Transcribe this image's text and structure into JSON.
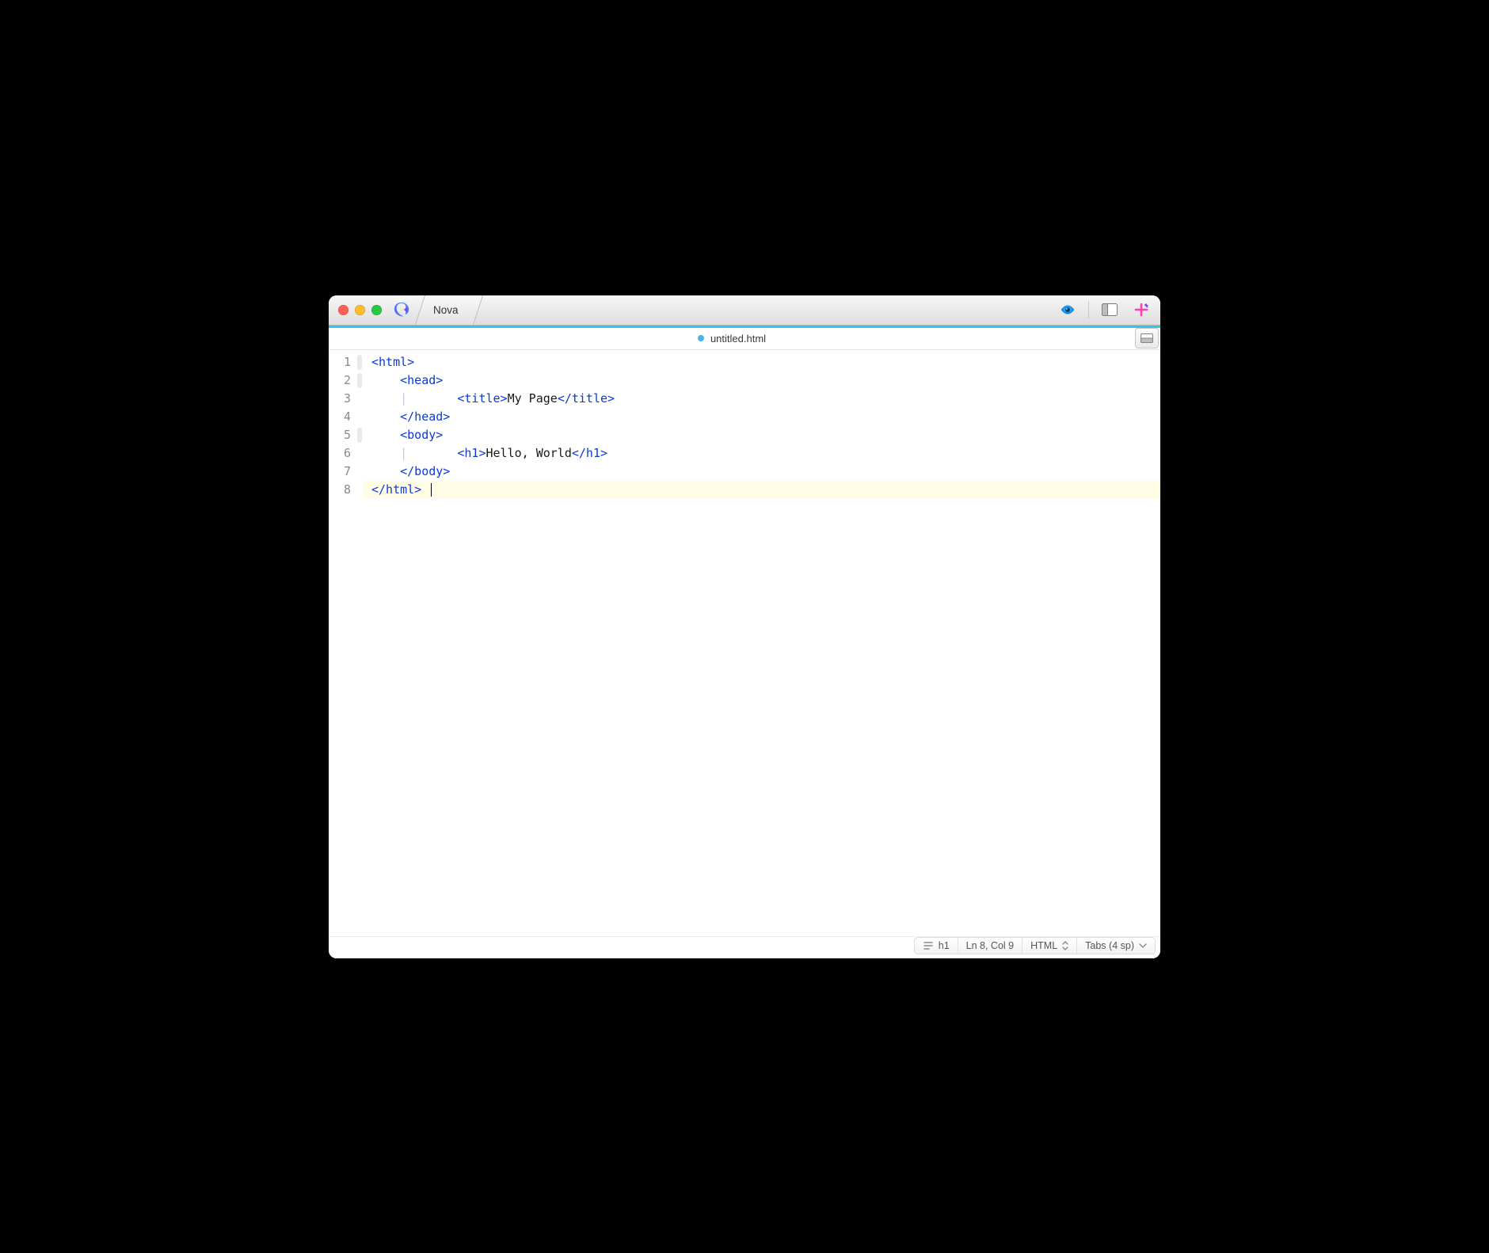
{
  "window": {
    "app_name": "Nova",
    "tab_title": "Nova",
    "file_tab": "untitled.html",
    "dirty": true
  },
  "editor": {
    "current_line_index": 7,
    "lines": [
      {
        "n": 1,
        "fold": true,
        "indent": 0,
        "segments": [
          {
            "c": "tag",
            "t": "<html>"
          }
        ]
      },
      {
        "n": 2,
        "fold": true,
        "indent": 1,
        "segments": [
          {
            "c": "tag",
            "t": "<head>"
          }
        ]
      },
      {
        "n": 3,
        "fold": false,
        "indent": 1,
        "guide": true,
        "extra_indent": 1,
        "segments": [
          {
            "c": "tag",
            "t": "<title>"
          },
          {
            "c": "txt",
            "t": "My Page"
          },
          {
            "c": "tag",
            "t": "</title>"
          }
        ]
      },
      {
        "n": 4,
        "fold": false,
        "indent": 1,
        "segments": [
          {
            "c": "tag",
            "t": "</head>"
          }
        ]
      },
      {
        "n": 5,
        "fold": true,
        "indent": 1,
        "segments": [
          {
            "c": "tag",
            "t": "<body>"
          }
        ]
      },
      {
        "n": 6,
        "fold": false,
        "indent": 1,
        "guide": true,
        "extra_indent": 1,
        "segments": [
          {
            "c": "tag",
            "t": "<h1>"
          },
          {
            "c": "txt",
            "t": "Hello, World"
          },
          {
            "c": "tag",
            "t": "</h1>"
          }
        ]
      },
      {
        "n": 7,
        "fold": false,
        "indent": 1,
        "segments": [
          {
            "c": "tag",
            "t": "</body>"
          }
        ]
      },
      {
        "n": 8,
        "fold": false,
        "indent": 0,
        "segments": [
          {
            "c": "tag",
            "t": "</html>"
          }
        ],
        "caret_after": true
      }
    ]
  },
  "status": {
    "symbol": "h1",
    "position": "Ln 8, Col 9",
    "language": "HTML",
    "indent": "Tabs (4 sp)"
  },
  "icons": {
    "preview": "eye-icon",
    "sidebar": "sidebar-icon",
    "add": "plus-icon",
    "panel": "panel-icon"
  }
}
